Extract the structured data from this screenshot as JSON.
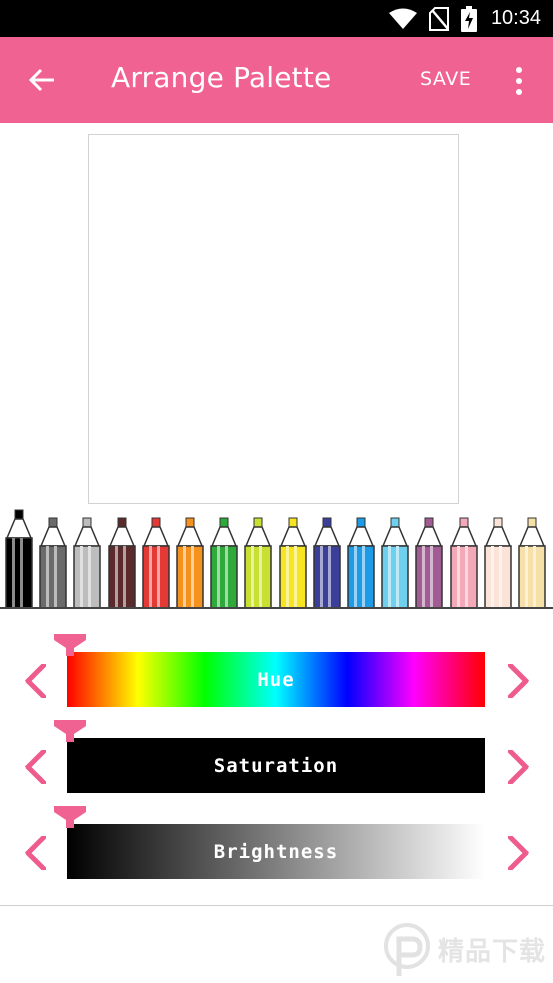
{
  "status_bar": {
    "time": "10:34"
  },
  "app_bar": {
    "title": "Arrange Palette",
    "save_label": "SAVE"
  },
  "pencils": [
    {
      "color": "#000000",
      "selected": true
    },
    {
      "color": "#6b6b6b"
    },
    {
      "color": "#bdbdbd"
    },
    {
      "color": "#5b2a2a"
    },
    {
      "color": "#e53935"
    },
    {
      "color": "#f5921e"
    },
    {
      "color": "#2eaa3b"
    },
    {
      "color": "#c9e033"
    },
    {
      "color": "#f7e521"
    },
    {
      "color": "#3b3f99"
    },
    {
      "color": "#1e9be6"
    },
    {
      "color": "#6fd0ee"
    },
    {
      "color": "#a05c93"
    },
    {
      "color": "#f3a9b8"
    },
    {
      "color": "#fbe3d8"
    },
    {
      "color": "#f7e0a8"
    }
  ],
  "sliders": {
    "hue": {
      "label": "Hue",
      "value": 0
    },
    "saturation": {
      "label": "Saturation",
      "value": 0
    },
    "brightness": {
      "label": "Brightness",
      "value": 0
    }
  },
  "watermark": {
    "text": "精品下载"
  },
  "accent_color": "#f06292",
  "arrow_color": "#ee5c8d"
}
